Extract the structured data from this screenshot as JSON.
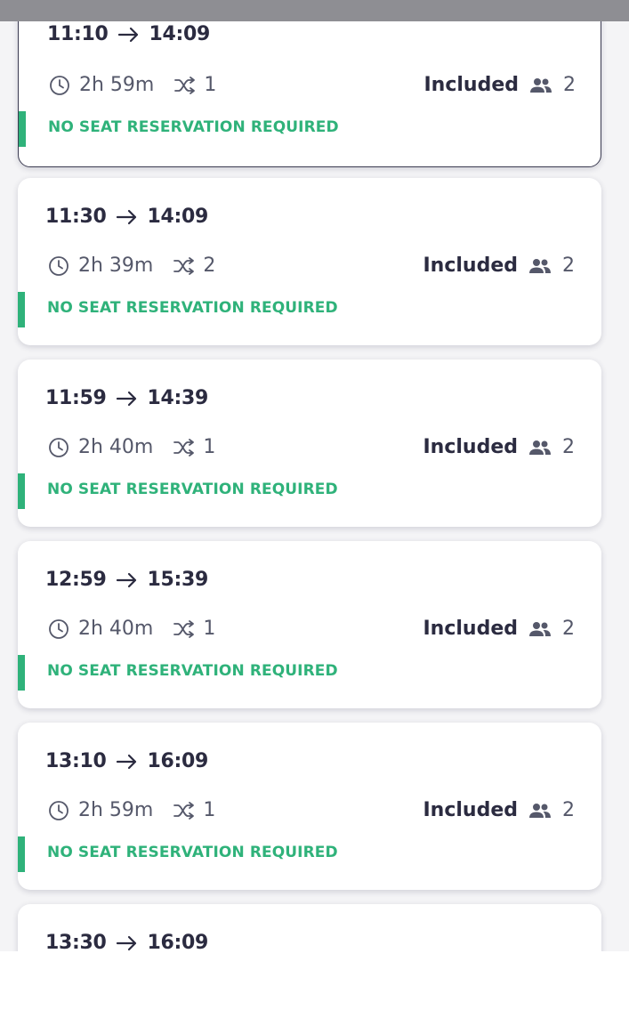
{
  "results": [
    {
      "departure": "11:10",
      "arrival": "14:09",
      "duration": "2h 59m",
      "changes": "1",
      "price": "Included",
      "passengers": "2",
      "seat_note": "NO SEAT RESERVATION REQUIRED"
    },
    {
      "departure": "11:30",
      "arrival": "14:09",
      "duration": "2h 39m",
      "changes": "2",
      "price": "Included",
      "passengers": "2",
      "seat_note": "NO SEAT RESERVATION REQUIRED"
    },
    {
      "departure": "11:59",
      "arrival": "14:39",
      "duration": "2h 40m",
      "changes": "1",
      "price": "Included",
      "passengers": "2",
      "seat_note": "NO SEAT RESERVATION REQUIRED"
    },
    {
      "departure": "12:59",
      "arrival": "15:39",
      "duration": "2h 40m",
      "changes": "1",
      "price": "Included",
      "passengers": "2",
      "seat_note": "NO SEAT RESERVATION REQUIRED"
    },
    {
      "departure": "13:10",
      "arrival": "16:09",
      "duration": "2h 59m",
      "changes": "1",
      "price": "Included",
      "passengers": "2",
      "seat_note": "NO SEAT RESERVATION REQUIRED"
    },
    {
      "departure": "13:30",
      "arrival": "16:09"
    }
  ],
  "icons": {
    "arrow": "arrow-right-icon",
    "duration": "clock-icon",
    "changes": "shuffle-icon",
    "passengers": "people-icon"
  },
  "colors": {
    "text_primary": "#2b2b40",
    "text_secondary": "#55586a",
    "seat_note_green": "#2fb27a",
    "top_overlay": "#8e8e93"
  }
}
